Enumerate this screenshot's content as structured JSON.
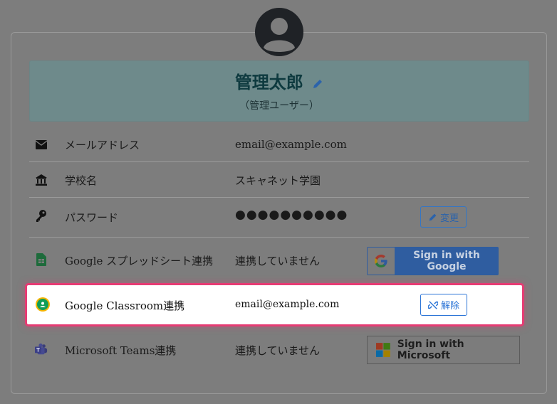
{
  "profile": {
    "name": "管理太郎",
    "role": "（管理ユーザー）"
  },
  "rows": [
    {
      "label": "メールアドレス",
      "value": "email@example.com",
      "icon": "envelope-icon"
    },
    {
      "label": "学校名",
      "value": "スキャネット学園",
      "icon": "school-icon"
    },
    {
      "label": "パスワード",
      "value": "●●●●●●●●●●",
      "icon": "key-icon",
      "action": "変更"
    },
    {
      "label": "Google スプレッドシート連携",
      "value": "連携していません",
      "icon": "google-sheets-icon",
      "action": "Sign in with Google"
    },
    {
      "label": "Google Classroom連携",
      "value": "email@example.com",
      "icon": "google-classroom-icon",
      "action": "解除"
    },
    {
      "label": "Microsoft Teams連携",
      "value": "連携していません",
      "icon": "microsoft-teams-icon",
      "action": "Sign in with Microsoft"
    }
  ],
  "colors": {
    "accent": "#3476c5",
    "highlight_border": "#e63b73",
    "google_button": "#2f5da0"
  }
}
